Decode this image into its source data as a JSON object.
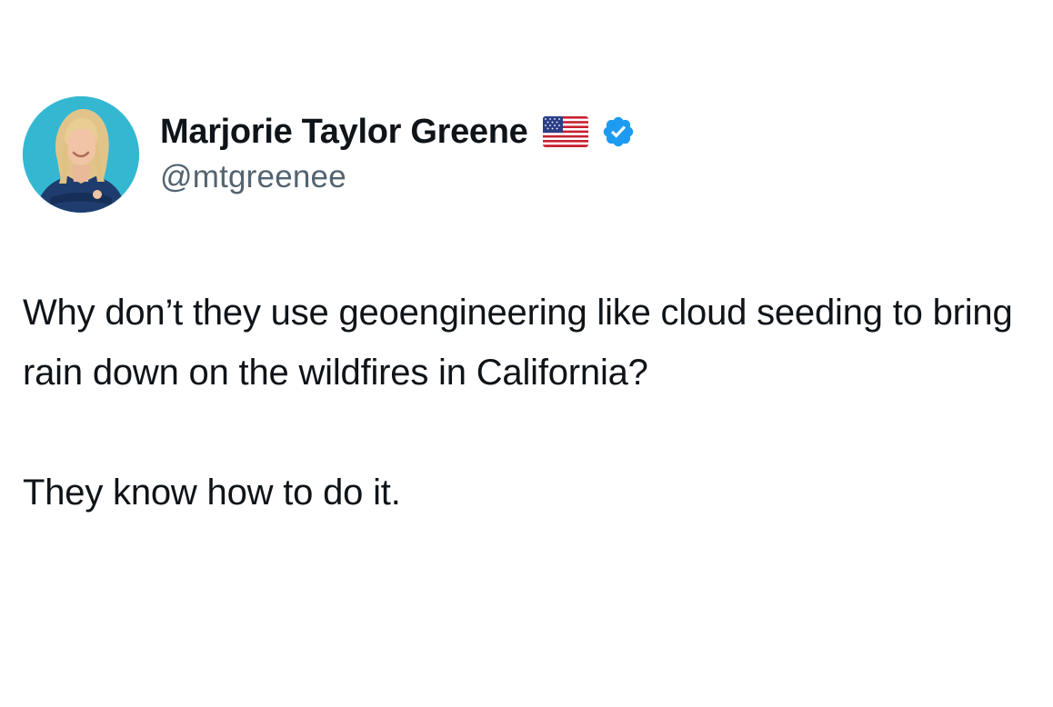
{
  "tweet": {
    "author": {
      "display_name": "Marjorie Taylor Greene",
      "handle": "@mtgreenee",
      "flag_icon": "us-flag-icon",
      "verified_icon": "verified-badge-icon",
      "verified_color": "#1d9bf0",
      "avatar_background": "#33b7d1"
    },
    "paragraphs": [
      "Why don’t they use geoengineering like cloud seeding to bring rain down on the wildfires in California?",
      "They know how to do it."
    ]
  }
}
